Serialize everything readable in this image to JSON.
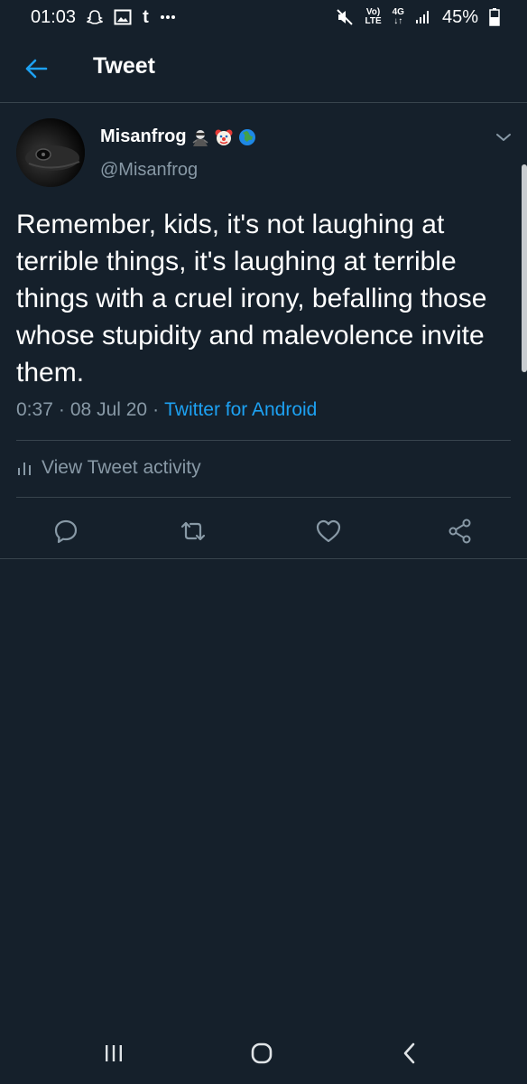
{
  "status_bar": {
    "time": "01:03",
    "battery": "45%",
    "network_top": "Vo)",
    "network_bottom": "LTE",
    "net_gen": "4G",
    "icons": [
      "snapchat-icon",
      "gallery-icon",
      "tumblr-icon",
      "more-dots-icon",
      "mute-icon",
      "volte-icon",
      "data-arrows-icon",
      "signal-icon",
      "battery-icon"
    ]
  },
  "header": {
    "title": "Tweet"
  },
  "tweet": {
    "display_name": "Misanfrog",
    "name_emojis": [
      "ninja-emoji-icon",
      "clown-emoji-icon",
      "globe-emoji-icon"
    ],
    "handle": "@Misanfrog",
    "text": "Remember, kids, it's not laughing at terrible things, it's laughing at terrible things with a cruel irony, befalling those whose stupidity and malevolence invite them.",
    "time": "0:37",
    "date": "08 Jul 20",
    "source": "Twitter for Android",
    "separator": "·",
    "activity_label": "View Tweet activity"
  },
  "colors": {
    "background": "#15202b",
    "accent": "#1da1f2",
    "secondary_text": "#8899a6",
    "divider": "#38444d"
  }
}
